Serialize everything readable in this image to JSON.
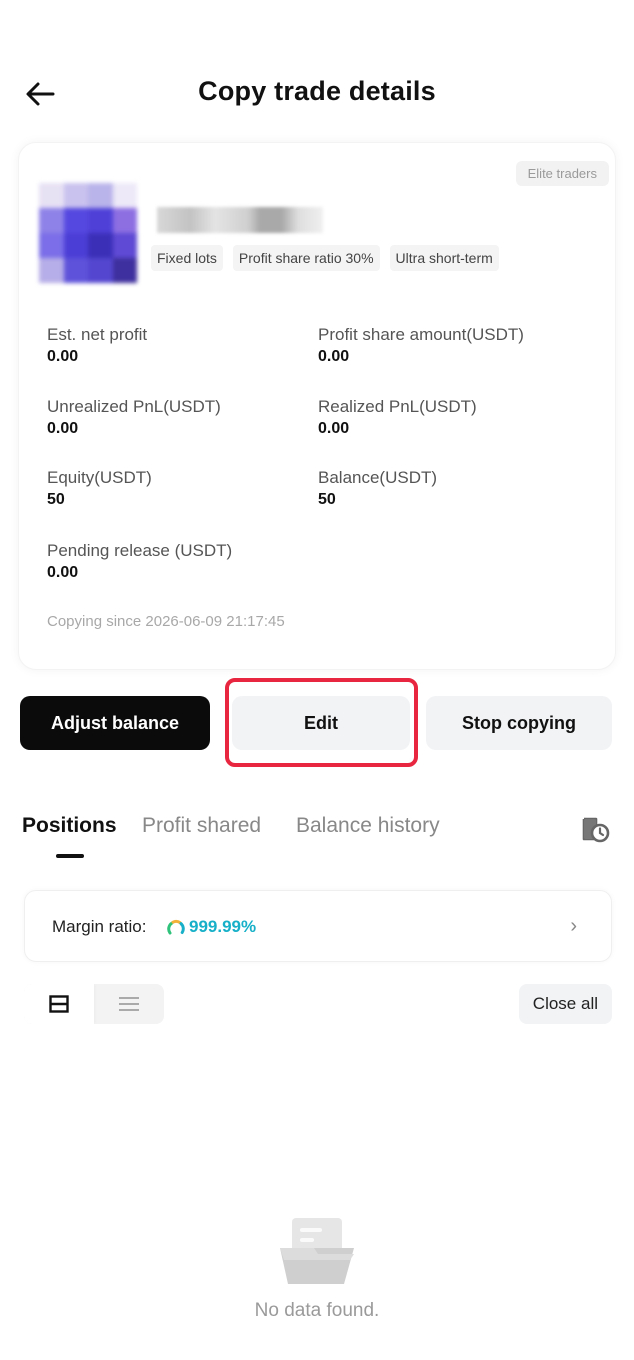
{
  "header": {
    "title": "Copy trade details"
  },
  "trader": {
    "badge": "Elite traders",
    "tags": [
      "Fixed lots",
      "Profit share ratio 30%",
      "Ultra short-term"
    ]
  },
  "stats": [
    {
      "label": "Est. net profit",
      "value": "0.00"
    },
    {
      "label": "Profit share amount(USDT)",
      "value": "0.00"
    },
    {
      "label": "Unrealized PnL(USDT)",
      "value": "0.00"
    },
    {
      "label": "Realized PnL(USDT)",
      "value": "0.00"
    },
    {
      "label": "Equity(USDT)",
      "value": "50"
    },
    {
      "label": "Balance(USDT)",
      "value": "50"
    },
    {
      "label": "Pending release (USDT)",
      "value": "0.00"
    }
  ],
  "copying_since": "Copying since 2026-06-09 21:17:45",
  "actions": {
    "adjust_balance": "Adjust balance",
    "edit": "Edit",
    "stop_copying": "Stop copying"
  },
  "tabs": [
    {
      "label": "Positions",
      "active": true
    },
    {
      "label": "Profit shared",
      "active": false
    },
    {
      "label": "Balance history",
      "active": false
    }
  ],
  "margin": {
    "label": "Margin ratio:",
    "value": "999.99%",
    "value_color": "#17b0c8"
  },
  "list_controls": {
    "close_all": "Close all"
  },
  "empty_state": {
    "text": "No data found."
  },
  "colors": {
    "primary_button": "#0b0b0b",
    "highlight": "#e8263f"
  },
  "icons": {
    "back": "arrow-left-icon",
    "history": "order-history-icon",
    "card_view": "card-view-icon",
    "list_view": "list-view-icon",
    "chevron": "chevron-right-icon",
    "empty": "empty-document-icon"
  }
}
